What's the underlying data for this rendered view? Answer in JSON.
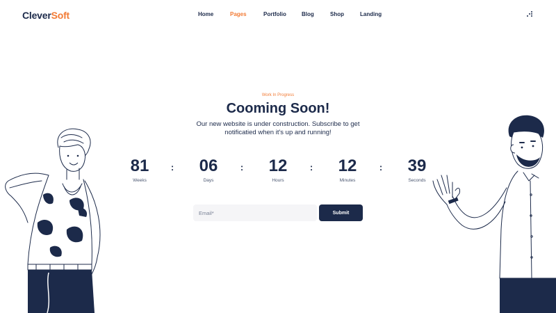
{
  "brand": {
    "part1": "Clever",
    "part2": "Soft"
  },
  "nav": {
    "items": [
      {
        "label": "Home"
      },
      {
        "label": "Pages"
      },
      {
        "label": "Portfolio"
      },
      {
        "label": "Blog"
      },
      {
        "label": "Shop"
      },
      {
        "label": "Landing"
      }
    ],
    "active": "Pages",
    "menu_icon": "dots-grid-icon"
  },
  "hero": {
    "eyebrow": "Work In Progress",
    "title": "Cooming Soon!",
    "subtitle": "Our new website is under construction. Subscribe to get notificatied when it's up and running!"
  },
  "countdown": [
    {
      "value": "81",
      "label": "Weeks"
    },
    {
      "value": "06",
      "label": "Days"
    },
    {
      "value": "12",
      "label": "Hours"
    },
    {
      "value": "12",
      "label": "Minutes"
    },
    {
      "value": "39",
      "label": "Seconds"
    }
  ],
  "countdown_separator": ":",
  "subscribe": {
    "placeholder": "Email*",
    "button_label": "Submit"
  },
  "colors": {
    "navy": "#1c2a4a",
    "accent": "#f27b35",
    "input_bg": "#f5f5f7"
  }
}
